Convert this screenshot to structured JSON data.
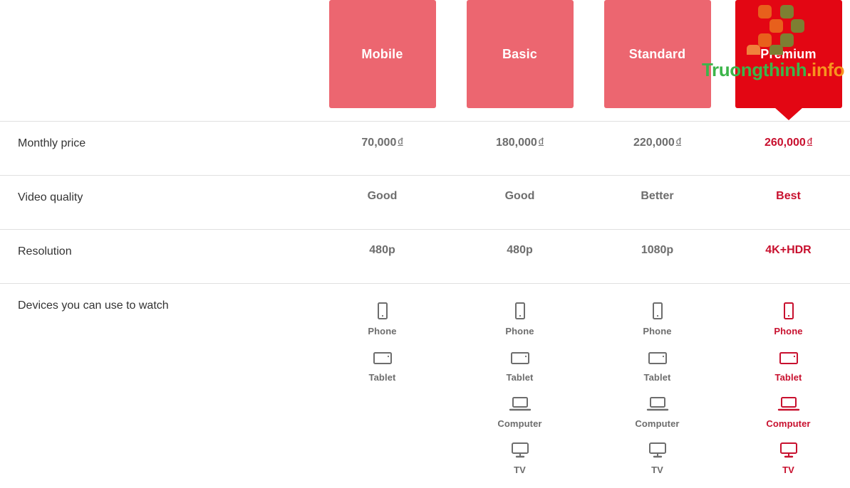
{
  "plans": [
    {
      "name": "Mobile",
      "price": "70,000",
      "currency": "đ",
      "quality": "Good",
      "resolution": "480p",
      "highlight": false,
      "devices": [
        "Phone",
        "Tablet"
      ]
    },
    {
      "name": "Basic",
      "price": "180,000",
      "currency": "đ",
      "quality": "Good",
      "resolution": "480p",
      "highlight": false,
      "devices": [
        "Phone",
        "Tablet",
        "Computer",
        "TV"
      ]
    },
    {
      "name": "Standard",
      "price": "220,000",
      "currency": "đ",
      "quality": "Better",
      "resolution": "1080p",
      "highlight": false,
      "devices": [
        "Phone",
        "Tablet",
        "Computer",
        "TV"
      ]
    },
    {
      "name": "Premium",
      "price": "260,000",
      "currency": "đ",
      "quality": "Best",
      "resolution": "4K+HDR",
      "highlight": true,
      "devices": [
        "Phone",
        "Tablet",
        "Computer",
        "TV"
      ]
    }
  ],
  "rows": {
    "price_label": "Monthly price",
    "quality_label": "Video quality",
    "resolution_label": "Resolution",
    "devices_label": "Devices you can use to watch"
  },
  "device_icons": {
    "Phone": "phone-icon",
    "Tablet": "tablet-icon",
    "Computer": "computer-icon",
    "TV": "tv-icon"
  },
  "watermark": {
    "text_primary": "Truongthinh",
    "text_secondary": ".info",
    "logo": "checker-squares-logo"
  },
  "colors": {
    "card_standard": "#ec6670",
    "card_premium": "#e30613",
    "highlight_text": "#c8102e",
    "value_text": "#6d6d6d",
    "label_text": "#333333",
    "divider": "#e0e0e0",
    "watermark_green": "#3cb54a",
    "watermark_orange": "#f7941e"
  }
}
